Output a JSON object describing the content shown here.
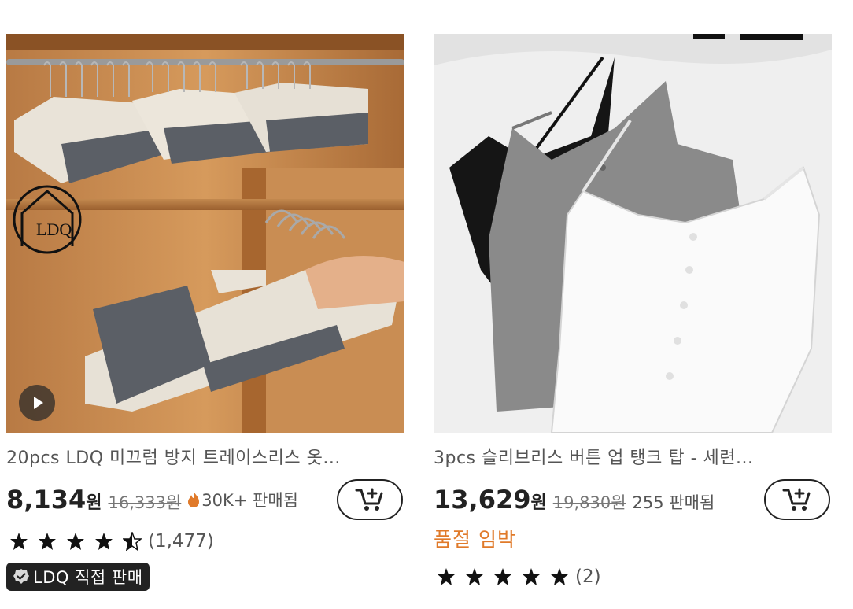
{
  "products": [
    {
      "title": "20pcs LDQ 미끄럼 방지 트레이스리스 옷...",
      "price": "8,134",
      "currency": "원",
      "original_price": "16,333원",
      "sold": "30K+ 판매됨",
      "rating": 4.5,
      "review_count": "(1,477)",
      "badge": "LDQ 직접 판매",
      "watermark": "LDQ",
      "has_video": true
    },
    {
      "title": "3pcs 슬리브리스 버튼 업 탱크 탑 - 세련...",
      "price": "13,629",
      "currency": "원",
      "original_price": "19,830원",
      "sold": "255 판매됨",
      "status": "품절 임박",
      "rating": 5,
      "review_count": "(2)"
    }
  ],
  "colors": {
    "accent_orange": "#e07a2a",
    "text_dark": "#222222",
    "badge_bg": "#222222"
  },
  "icons": {
    "cart": "cart-plus-icon",
    "fire": "fire-icon",
    "star": "star-icon",
    "play": "play-icon",
    "verified": "verified-icon"
  }
}
